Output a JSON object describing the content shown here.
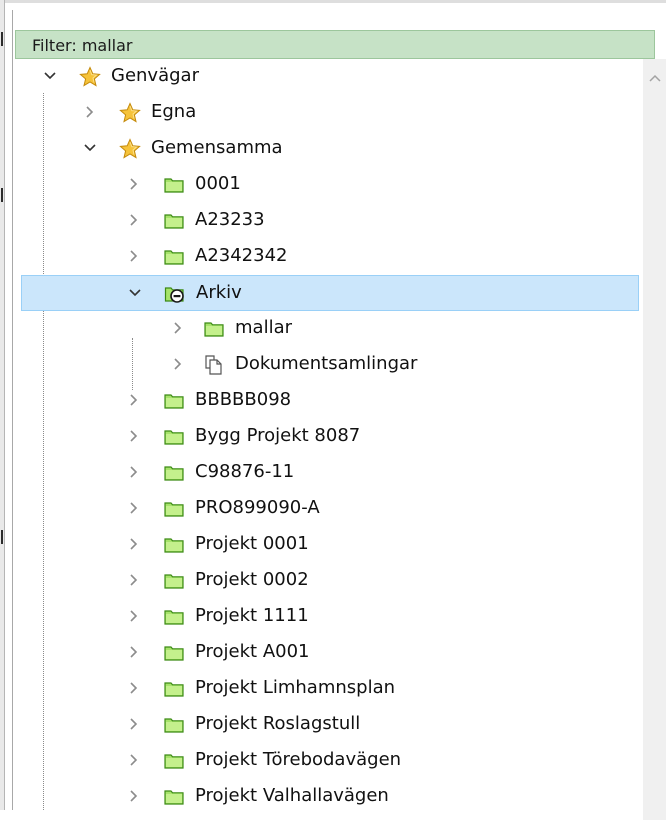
{
  "filter": {
    "label": "Filter: mallar"
  },
  "tree": {
    "root": {
      "label": "Genvägar",
      "icon": "star-icon",
      "expanded": true
    },
    "egna": {
      "label": "Egna",
      "icon": "star-icon",
      "expanded": false
    },
    "gemensamma": {
      "label": "Gemensamma",
      "icon": "star-icon",
      "expanded": true
    },
    "folders_before": [
      {
        "label": "0001",
        "icon": "folder-icon"
      },
      {
        "label": "A23233",
        "icon": "folder-icon"
      },
      {
        "label": "A2342342",
        "icon": "folder-icon"
      }
    ],
    "arkiv": {
      "label": "Arkiv",
      "icon": "archive-folder-icon",
      "expanded": true,
      "selected": true,
      "children": [
        {
          "label": "mallar",
          "icon": "folder-icon"
        },
        {
          "label": "Dokumentsamlingar",
          "icon": "document-collection-icon"
        }
      ]
    },
    "folders_after": [
      {
        "label": "BBBBB098",
        "icon": "folder-icon"
      },
      {
        "label": "Bygg Projekt 8087",
        "icon": "folder-icon"
      },
      {
        "label": "C98876-11",
        "icon": "folder-icon"
      },
      {
        "label": "PRO899090-A",
        "icon": "folder-icon"
      },
      {
        "label": "Projekt 0001",
        "icon": "folder-icon"
      },
      {
        "label": "Projekt 0002",
        "icon": "folder-icon"
      },
      {
        "label": "Projekt 1111",
        "icon": "folder-icon"
      },
      {
        "label": "Projekt A001",
        "icon": "folder-icon"
      },
      {
        "label": "Projekt Limhamnsplan",
        "icon": "folder-icon"
      },
      {
        "label": "Projekt Roslagstull",
        "icon": "folder-icon"
      },
      {
        "label": "Projekt Törebodavägen",
        "icon": "folder-icon"
      },
      {
        "label": "Projekt Valhallavägen",
        "icon": "folder-icon"
      }
    ]
  },
  "colors": {
    "filter_background": "#c6e2c6",
    "selection_background": "#cbe6fb",
    "folder_fill": "#a6e36a",
    "folder_stroke": "#3c8a15",
    "star_fill": "#f6c33a"
  }
}
